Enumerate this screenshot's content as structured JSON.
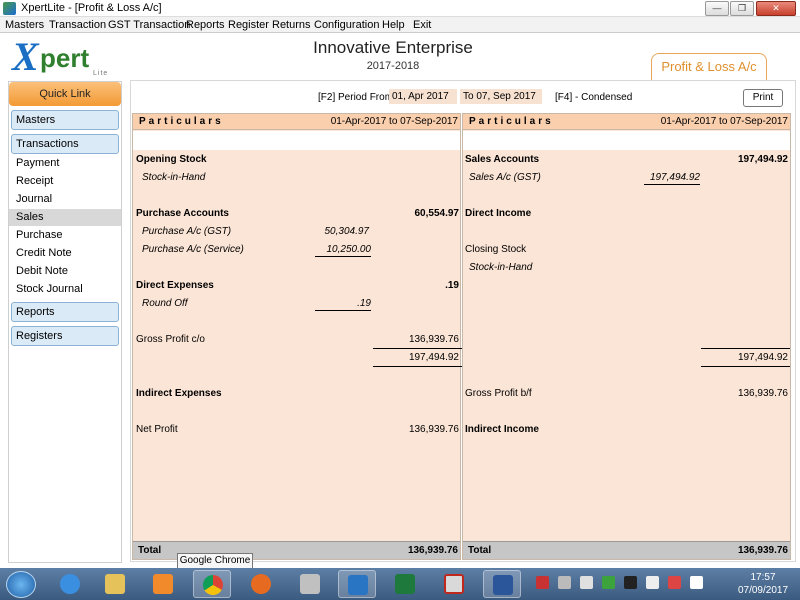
{
  "window": {
    "title": "XpertLite - [Profit & Loss A/c]"
  },
  "menu": [
    "Masters",
    "Transaction",
    "GST Transaction",
    "Reports",
    "Register",
    "Returns",
    "Configuration",
    "Help",
    "Exit"
  ],
  "header": {
    "logo_text_x": "X",
    "logo_text_pert": "pert",
    "logo_text_lite": "Lite",
    "company": "Innovative Enterprise",
    "financial_year": "2017-2018",
    "active_tab": "Profit & Loss A/c"
  },
  "sidebar": {
    "quick_link": "Quick Link",
    "masters": "Masters",
    "transactions": "Transactions",
    "transaction_items": [
      "Payment",
      "Receipt",
      "Journal",
      "Sales",
      "Purchase",
      "Credit Note",
      "Debit Note",
      "Stock Journal"
    ],
    "active_item": "Sales",
    "reports": "Reports",
    "registers": "Registers"
  },
  "toolbar": {
    "period_label": "[F2] Period From",
    "from_date": "01, Apr 2017",
    "to_label": "To 07, Sep 2017",
    "condensed": "[F4] - Condensed",
    "print": "Print"
  },
  "left": {
    "header_label": "Particulars",
    "header_range": "01-Apr-2017 to 07-Sep-2017",
    "opening_stock": "Opening Stock",
    "stock_in_hand": "Stock-in-Hand",
    "purchase_accounts": "Purchase Accounts",
    "purchase_accounts_amt": "60,554.97",
    "purchase_gst": "Purchase A/c (GST)",
    "purchase_gst_amt": "50,304.97",
    "purchase_service": "Purchase A/c (Service)",
    "purchase_service_amt": "10,250.00",
    "direct_expenses": "Direct Expenses",
    "direct_expenses_amt": ".19",
    "round_off": "Round Off",
    "round_off_amt": ".19",
    "gross_profit_co": "Gross Profit c/o",
    "gross_profit_co_amt": "136,939.76",
    "subtotal": "197,494.92",
    "indirect_expenses": "Indirect Expenses",
    "net_profit": "Net Profit",
    "net_profit_amt": "136,939.76",
    "total_label": "Total",
    "total_amt": "136,939.76"
  },
  "right": {
    "header_label": "Particulars",
    "header_range": "01-Apr-2017 to 07-Sep-2017",
    "sales_accounts": "Sales Accounts",
    "sales_accounts_amt": "197,494.92",
    "sales_gst": "Sales A/c (GST)",
    "sales_gst_amt": "197,494.92",
    "direct_income": "Direct Income",
    "closing_stock": "Closing Stock",
    "stock_in_hand": "Stock-in-Hand",
    "subtotal": "197,494.92",
    "gross_profit_bf": "Gross Profit b/f",
    "gross_profit_bf_amt": "136,939.76",
    "indirect_income": "Indirect Income",
    "total_label": "Total",
    "total_amt": "136,939.76"
  },
  "tooltip": "Google Chrome",
  "taskbar": {
    "apps": [
      "internet-explorer-icon",
      "file-explorer-icon",
      "media-player-icon",
      "chrome-icon",
      "firefox-icon",
      "paint-icon",
      "xpertlite-icon",
      "excel-icon",
      "acrobat-icon",
      "word-icon"
    ],
    "time": "17:57",
    "date": "07/09/2017"
  },
  "colors": {
    "accent_orange": "#f39a34",
    "panel_peach": "#fbe5d6",
    "header_peach": "#f9cfae",
    "sidebar_blue": "#dbeaf7"
  }
}
